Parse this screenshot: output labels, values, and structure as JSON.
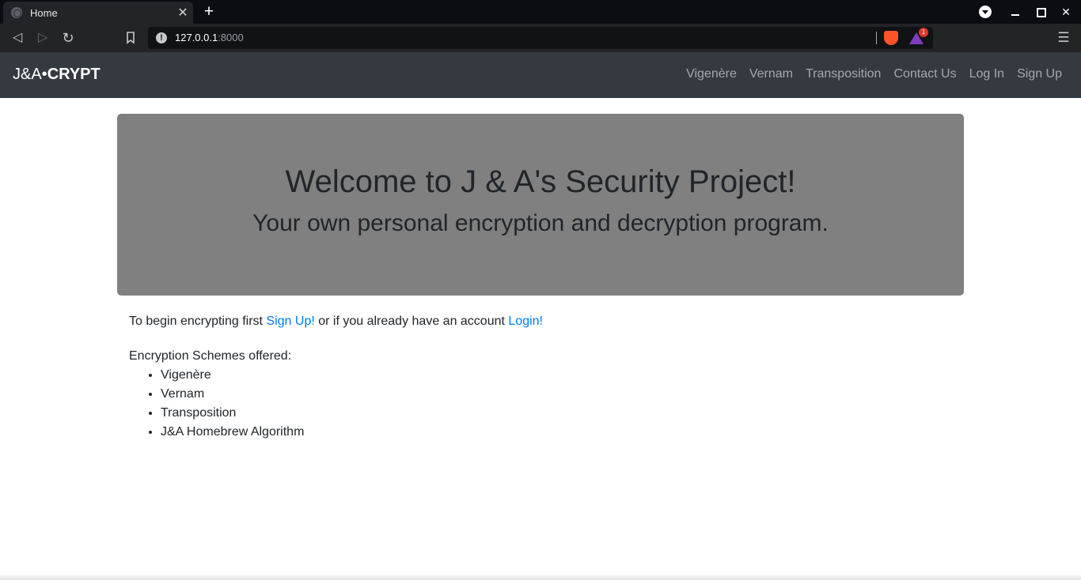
{
  "browser": {
    "tab_title": "Home",
    "tab_close": "✕",
    "new_tab": "+",
    "url_host": "127.0.0.1",
    "url_port": ":8000",
    "notification_count": "1"
  },
  "navbar": {
    "brand_light": "J&A•",
    "brand_bold": "CRYPT",
    "links": [
      "Vigenère",
      "Vernam",
      "Transposition",
      "Contact Us",
      "Log In",
      "Sign Up"
    ]
  },
  "hero": {
    "title": "Welcome to J & A's Security Project!",
    "subtitle": "Your own personal encryption and decryption program."
  },
  "intro": {
    "prefix": "To begin encrypting first ",
    "signup_link": "Sign Up!",
    "middle": " or if you already have an account ",
    "login_link": "Login!"
  },
  "schemes": {
    "title": "Encryption Schemes offered:",
    "items": [
      "Vigenère",
      "Vernam",
      "Transposition",
      "J&A Homebrew Algorithm"
    ]
  },
  "colors": {
    "navbar_bg": "#343a40",
    "hero_bg": "#808080",
    "link": "#007bff"
  }
}
